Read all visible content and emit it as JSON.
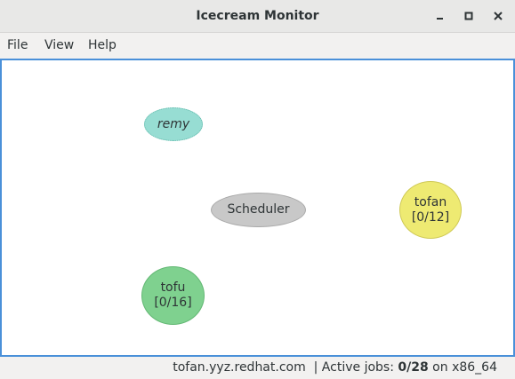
{
  "window": {
    "title": "Icecream Monitor"
  },
  "menu": {
    "items": [
      "File",
      "View",
      "Help"
    ]
  },
  "nodes": {
    "remy": {
      "name": "remy"
    },
    "scheduler": {
      "name": "Scheduler"
    },
    "tofan": {
      "name": "tofan",
      "jobs": "[0/12]"
    },
    "tofu": {
      "name": "tofu",
      "jobs": "[0/16]"
    }
  },
  "colors": {
    "remy_fill": "#97ddd3",
    "scheduler_fill": "#c8c8c8",
    "tofan_fill": "#eeea72",
    "tofu_fill": "#7fd18f",
    "canvas_border": "#4a90d9"
  },
  "status": {
    "host": "tofan.yyz.redhat.com",
    "active_label": "| Active jobs:",
    "active_jobs": "0/28",
    "arch_prefix": "on",
    "arch": "x86_64"
  }
}
